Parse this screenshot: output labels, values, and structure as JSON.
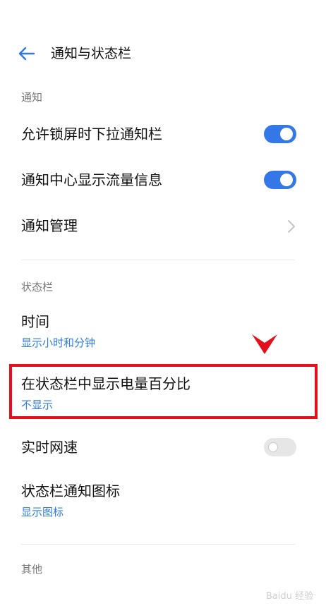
{
  "header": {
    "title": "通知与状态栏"
  },
  "sections": {
    "notification": {
      "label": "通知",
      "items": [
        {
          "title": "允许锁屏时下拉通知栏",
          "toggle": "on"
        },
        {
          "title": "通知中心显示流量信息",
          "toggle": "on"
        },
        {
          "title": "通知管理",
          "chevron": true
        }
      ]
    },
    "statusbar": {
      "label": "状态栏",
      "items": [
        {
          "title": "时间",
          "subtitle": "显示小时和分钟"
        },
        {
          "title": "在状态栏中显示电量百分比",
          "subtitle": "不显示"
        },
        {
          "title": "实时网速",
          "toggle": "off"
        },
        {
          "title": "状态栏通知图标",
          "subtitle": "显示图标"
        }
      ]
    },
    "other": {
      "label": "其他"
    }
  },
  "watermark": "Baidu 经验",
  "colors": {
    "accent": "#3478e8",
    "subtitle": "#2f7de1",
    "highlight": "#e3101c"
  }
}
